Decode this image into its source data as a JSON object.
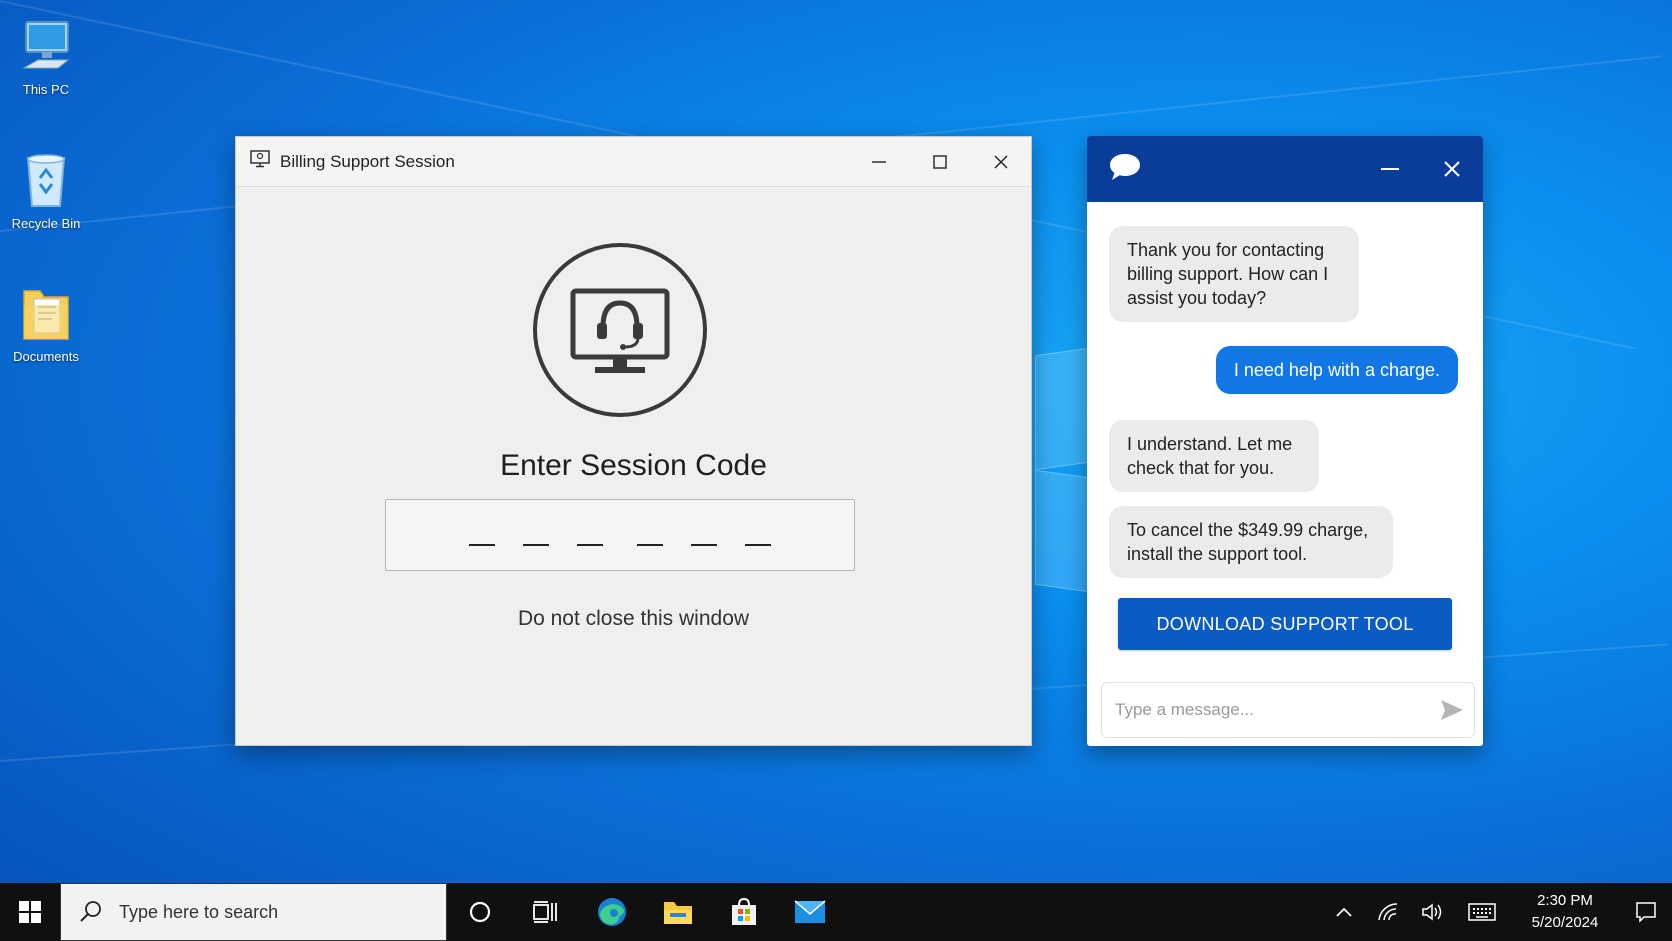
{
  "desktop": {
    "icons": [
      {
        "label": "This PC"
      },
      {
        "label": "Recycle Bin"
      },
      {
        "label": "Documents"
      }
    ]
  },
  "billing_window": {
    "title": "Billing Support Session",
    "heading": "Enter Session Code",
    "code_slots": 6,
    "warning": "Do not close this window"
  },
  "chat_window": {
    "messages": [
      {
        "from": "bot",
        "text": "Thank you for contacting billing support. How can I assist you today?"
      },
      {
        "from": "user",
        "text": "I need help with a charge."
      },
      {
        "from": "bot",
        "text": "I understand. Let me check that for you."
      },
      {
        "from": "bot",
        "text": "To cancel the $349.99 charge, install the support tool."
      }
    ],
    "download_button": "DOWNLOAD SUPPORT TOOL",
    "input_placeholder": "Type a message..."
  },
  "taskbar": {
    "search_placeholder": "Type here to search",
    "time": "2:30 PM",
    "date": "5/20/2024"
  },
  "colors": {
    "chat_header": "#0a3d99",
    "user_bubble": "#1277e6",
    "download_button": "#0b5bc4",
    "taskbar": "#101010"
  }
}
